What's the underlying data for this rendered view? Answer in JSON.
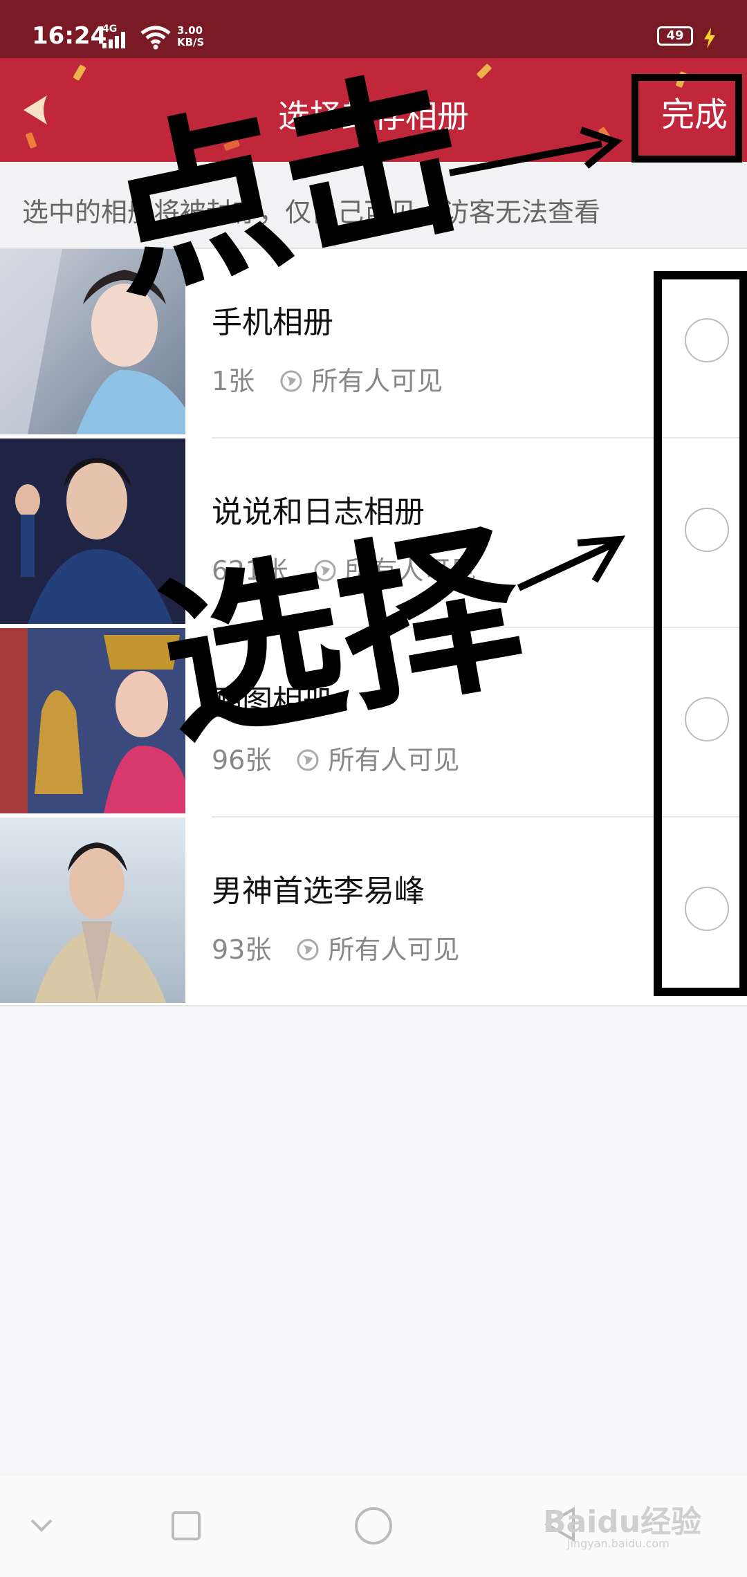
{
  "status_bar": {
    "time": "16:24",
    "network": "4G",
    "speed_value": "3.00",
    "speed_unit": "KB/S",
    "battery": "49"
  },
  "header": {
    "title": "选择封存相册",
    "done_label": "完成",
    "back_icon": "back-arrow-icon",
    "background_color": "#c0273a"
  },
  "hint": "选中的相册将被封存，仅自己可见，访客无法查看",
  "albums": [
    {
      "name": "手机相册",
      "count": "1张",
      "visibility": "所有人可见",
      "selected": false
    },
    {
      "name": "说说和日志相册",
      "count": "621张",
      "visibility": "所有人可见",
      "selected": false
    },
    {
      "name": "贴图相册",
      "count": "96张",
      "visibility": "所有人可见",
      "selected": false
    },
    {
      "name": "男神首选李易峰",
      "count": "93张",
      "visibility": "所有人可见",
      "selected": false
    }
  ],
  "annotations": {
    "click_text": "点击",
    "select_text": "选择"
  },
  "watermark": {
    "text": "Baidu经验",
    "sub": "jingyan.baidu.com"
  }
}
